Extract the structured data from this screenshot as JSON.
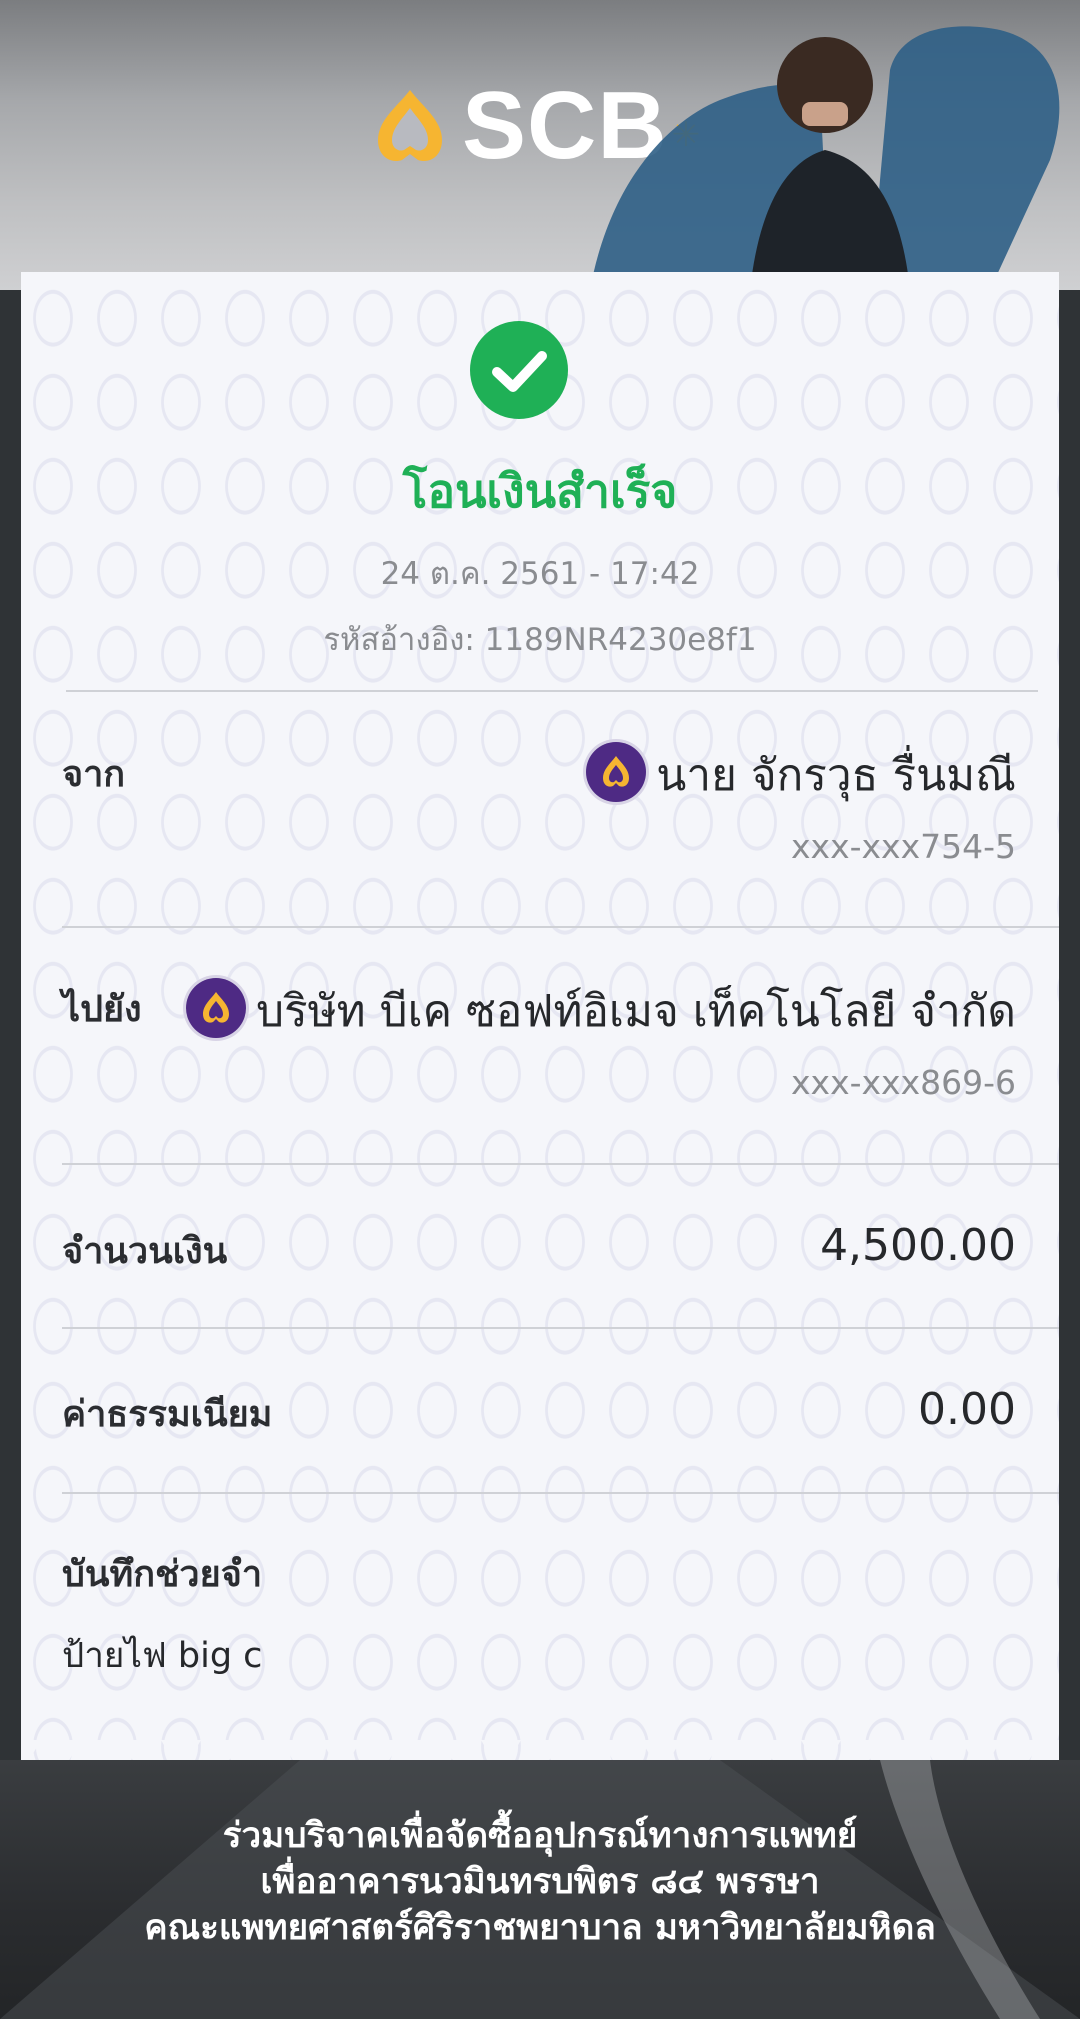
{
  "header": {
    "brand": "SCB",
    "colors": {
      "brand_gold": "#f6b531",
      "brand_purple": "#4e2a84"
    }
  },
  "status": {
    "icon": "check-circle-icon",
    "title": "โอนเงินสำเร็จ",
    "datetime": "24 ต.ค. 2561 - 17:42",
    "reference": "รหัสอ้างอิง: 1189NR4230e8f1",
    "color": "#1fb056"
  },
  "from": {
    "label": "จาก",
    "name": "นาย จักรวุธ รื่นมณี",
    "account": "xxx-xxx754-5"
  },
  "to": {
    "label": "ไปยัง",
    "name": "บริษัท บีเค ซอฟท์อิเมจ เท็คโนโลยี จำกัด",
    "account": "xxx-xxx869-6"
  },
  "amount": {
    "label": "จำนวนเงิน",
    "value": "4,500.00"
  },
  "fee": {
    "label": "ค่าธรรมเนียม",
    "value": "0.00"
  },
  "memo": {
    "label": "บันทึกช่วยจำ",
    "value": "ป้ายไฟ big c"
  },
  "footer": {
    "lines": [
      "ร่วมบริจาคเพื่อจัดซื้ออุปกรณ์ทางการแพทย์",
      "เพื่ออาคารนวมินทรบพิตร ๘๔ พรรษา",
      "คณะแพทยศาสตร์ศิริราชพยาบาล มหาวิทยาลัยมหิดล"
    ]
  }
}
